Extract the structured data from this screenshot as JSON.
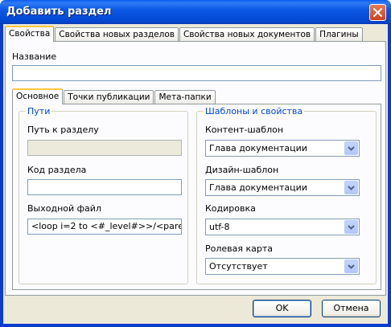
{
  "window": {
    "title": "Добавить раздел"
  },
  "top_tabs": [
    "Свойства",
    "Свойства новых разделов",
    "Свойства новых документов",
    "Плагины"
  ],
  "name_label": "Название",
  "name_value": "",
  "inner_tabs": [
    "Основное",
    "Точки публикации",
    "Мета-папки"
  ],
  "paths": {
    "title": "Пути",
    "section_path_label": "Путь к разделу",
    "section_path_value": "",
    "section_code_label": "Код раздела",
    "section_code_value": "",
    "output_file_label": "Выходной файл",
    "output_file_value": "<loop i=2 to <#_level#>>/<parent["
  },
  "templates": {
    "title": "Шаблоны и свойства",
    "content_template_label": "Контент-шаблон",
    "content_template_value": "Глава документации",
    "design_template_label": "Дизайн-шаблон",
    "design_template_value": "Глава документации",
    "encoding_label": "Кодировка",
    "encoding_value": "utf-8",
    "role_map_label": "Ролевая карта",
    "role_map_value": "Отсутствует"
  },
  "buttons": {
    "ok": "OK",
    "cancel": "Отмена"
  }
}
